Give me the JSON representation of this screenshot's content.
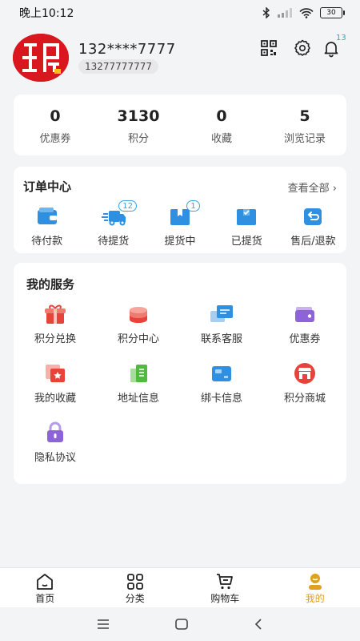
{
  "status": {
    "time": "晚上10:12",
    "battery": "30"
  },
  "profile": {
    "username": "132****7777",
    "phone": "13277777777",
    "notification_count": "13"
  },
  "stats": [
    {
      "value": "0",
      "label": "优惠券"
    },
    {
      "value": "3130",
      "label": "积分"
    },
    {
      "value": "0",
      "label": "收藏"
    },
    {
      "value": "5",
      "label": "浏览记录"
    }
  ],
  "orders": {
    "title": "订单中心",
    "view_all": "查看全部",
    "items": [
      {
        "label": "待付款",
        "icon": "wallet-icon"
      },
      {
        "label": "待提货",
        "icon": "truck-icon",
        "badge": "12"
      },
      {
        "label": "提货中",
        "icon": "box-icon",
        "badge": "1"
      },
      {
        "label": "已提货",
        "icon": "box-done-icon"
      },
      {
        "label": "售后/退款",
        "icon": "return-icon"
      }
    ]
  },
  "services": {
    "title": "我的服务",
    "items": [
      {
        "label": "积分兑换",
        "icon": "gift-icon"
      },
      {
        "label": "积分中心",
        "icon": "coins-icon"
      },
      {
        "label": "联系客服",
        "icon": "chat-icon"
      },
      {
        "label": "优惠券",
        "icon": "coupon-icon"
      },
      {
        "label": "我的收藏",
        "icon": "favorite-icon"
      },
      {
        "label": "地址信息",
        "icon": "address-icon"
      },
      {
        "label": "绑卡信息",
        "icon": "card-icon"
      },
      {
        "label": "积分商城",
        "icon": "store-icon"
      },
      {
        "label": "隐私协议",
        "icon": "lock-icon"
      }
    ]
  },
  "tabs": [
    {
      "label": "首页"
    },
    {
      "label": "分类"
    },
    {
      "label": "购物车"
    },
    {
      "label": "我的"
    }
  ],
  "colors": {
    "accent": "#e0a020",
    "blue": "#2f8fe0",
    "red": "#e8433a"
  }
}
